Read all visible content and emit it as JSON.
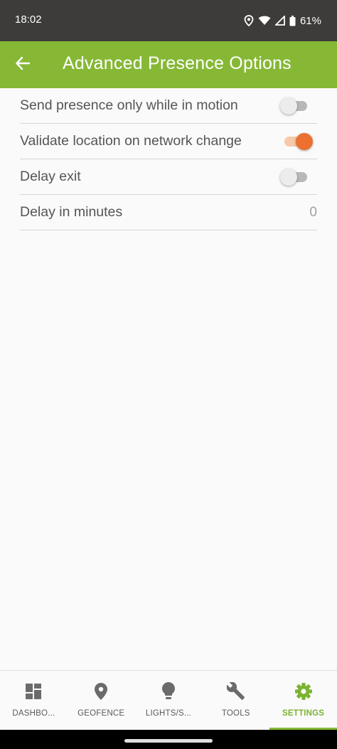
{
  "status_bar": {
    "time": "18:02",
    "battery": "61%",
    "icons": [
      "location-icon",
      "wifi-icon",
      "signal-icon",
      "battery-icon"
    ]
  },
  "app_bar": {
    "title": "Advanced Presence Options",
    "back_icon": "arrow-back-icon",
    "color": "#86b836"
  },
  "settings": [
    {
      "label": "Send presence only while in motion",
      "type": "toggle",
      "enabled": false
    },
    {
      "label": "Validate location on network change",
      "type": "toggle",
      "enabled": true
    },
    {
      "label": "Delay exit",
      "type": "toggle",
      "enabled": false
    },
    {
      "label": "Delay in minutes",
      "type": "value",
      "value": "0"
    }
  ],
  "bottom_nav": {
    "items": [
      {
        "label": "DASHBO...",
        "icon": "dashboard-icon",
        "active": false
      },
      {
        "label": "GEOFENCE",
        "icon": "location-pin-icon",
        "active": false
      },
      {
        "label": "LIGHTS/S...",
        "icon": "lightbulb-icon",
        "active": false
      },
      {
        "label": "TOOLS",
        "icon": "wrench-icon",
        "active": false
      },
      {
        "label": "SETTINGS",
        "icon": "gear-icon",
        "active": true
      }
    ]
  },
  "colors": {
    "accent": "#86b836",
    "toggle_on": "#ec7030",
    "status_bar": "#3d3c3a"
  }
}
